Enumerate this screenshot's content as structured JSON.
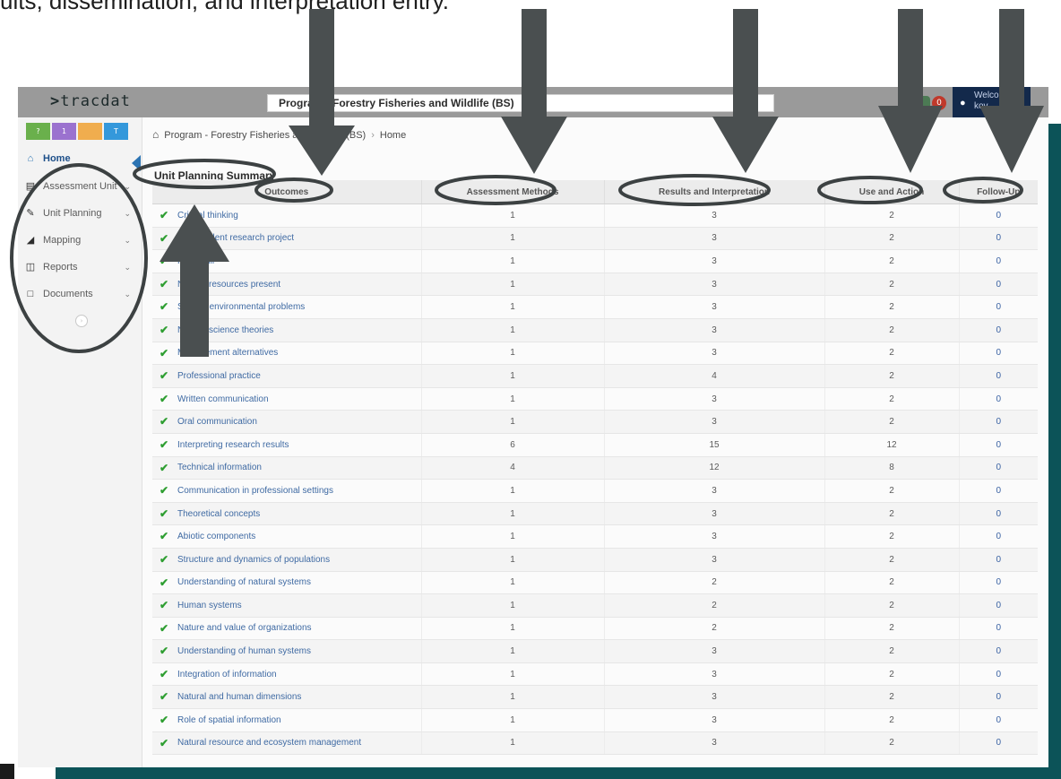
{
  "caption": "ults, dissemination, and interpretation entry.",
  "app": {
    "logo": "tracdat",
    "program_select": "Program - Forestry Fisheries and Wildlife (BS)",
    "notification_count": "0",
    "welcome_line1": "Welcome",
    "welcome_line2": "kov..."
  },
  "sidebar": {
    "quick_buttons": [
      {
        "label": "?",
        "color": "#6ab04c"
      },
      {
        "label": "1",
        "color": "#9b72cf"
      },
      {
        "label": "",
        "color": "#f0ad4e"
      },
      {
        "label": "T",
        "color": "#3498db"
      }
    ],
    "items": [
      {
        "label": "Home",
        "icon": "home-icon"
      },
      {
        "label": "Assessment Unit",
        "icon": "institution-icon"
      },
      {
        "label": "Unit Planning",
        "icon": "pencil-icon"
      },
      {
        "label": "Mapping",
        "icon": "sitemap-icon"
      },
      {
        "label": "Reports",
        "icon": "columns-icon"
      },
      {
        "label": "Documents",
        "icon": "folder-icon"
      }
    ]
  },
  "breadcrumb": {
    "program": "Program - Forestry Fisheries and Wildlife (BS)",
    "current": "Home"
  },
  "summary": {
    "title": "Unit Planning Summary",
    "columns": [
      "Outcomes",
      "Assessment Methods",
      "Results and Interpretation",
      "Use and Action",
      "Follow-Up"
    ],
    "rows": [
      {
        "outcome": "Critical thinking",
        "am": "1",
        "ri": "3",
        "ua": "2",
        "fu": "0"
      },
      {
        "outcome": "Independent research project",
        "am": "1",
        "ri": "3",
        "ua": "2",
        "fu": "0"
      },
      {
        "outcome": "Field skill",
        "am": "1",
        "ri": "3",
        "ua": "2",
        "fu": "0"
      },
      {
        "outcome": "Natural resources present",
        "am": "1",
        "ri": "3",
        "ua": "2",
        "fu": "0"
      },
      {
        "outcome": "Solving environmental problems",
        "am": "1",
        "ri": "3",
        "ua": "2",
        "fu": "0"
      },
      {
        "outcome": "Natural science theories",
        "am": "1",
        "ri": "3",
        "ua": "2",
        "fu": "0"
      },
      {
        "outcome": "Management alternatives",
        "am": "1",
        "ri": "3",
        "ua": "2",
        "fu": "0"
      },
      {
        "outcome": "Professional practice",
        "am": "1",
        "ri": "4",
        "ua": "2",
        "fu": "0"
      },
      {
        "outcome": "Written communication",
        "am": "1",
        "ri": "3",
        "ua": "2",
        "fu": "0"
      },
      {
        "outcome": "Oral communication",
        "am": "1",
        "ri": "3",
        "ua": "2",
        "fu": "0"
      },
      {
        "outcome": "Interpreting research results",
        "am": "6",
        "ri": "15",
        "ua": "12",
        "fu": "0"
      },
      {
        "outcome": "Technical information",
        "am": "4",
        "ri": "12",
        "ua": "8",
        "fu": "0"
      },
      {
        "outcome": "Communication in professional settings",
        "am": "1",
        "ri": "3",
        "ua": "2",
        "fu": "0"
      },
      {
        "outcome": "Theoretical concepts",
        "am": "1",
        "ri": "3",
        "ua": "2",
        "fu": "0"
      },
      {
        "outcome": "Abiotic components",
        "am": "1",
        "ri": "3",
        "ua": "2",
        "fu": "0"
      },
      {
        "outcome": "Structure and dynamics of populations",
        "am": "1",
        "ri": "3",
        "ua": "2",
        "fu": "0"
      },
      {
        "outcome": "Understanding of natural systems",
        "am": "1",
        "ri": "2",
        "ua": "2",
        "fu": "0"
      },
      {
        "outcome": "Human systems",
        "am": "1",
        "ri": "2",
        "ua": "2",
        "fu": "0"
      },
      {
        "outcome": "Nature and value of organizations",
        "am": "1",
        "ri": "2",
        "ua": "2",
        "fu": "0"
      },
      {
        "outcome": "Understanding of human systems",
        "am": "1",
        "ri": "3",
        "ua": "2",
        "fu": "0"
      },
      {
        "outcome": "Integration of information",
        "am": "1",
        "ri": "3",
        "ua": "2",
        "fu": "0"
      },
      {
        "outcome": "Natural and human dimensions",
        "am": "1",
        "ri": "3",
        "ua": "2",
        "fu": "0"
      },
      {
        "outcome": "Role of spatial information",
        "am": "1",
        "ri": "3",
        "ua": "2",
        "fu": "0"
      },
      {
        "outcome": "Natural resource and ecosystem management",
        "am": "1",
        "ri": "3",
        "ua": "2",
        "fu": "0"
      }
    ]
  },
  "annotation": {
    "arrow_color": "#4a4f50",
    "ellipse_color": "#3c4142"
  }
}
